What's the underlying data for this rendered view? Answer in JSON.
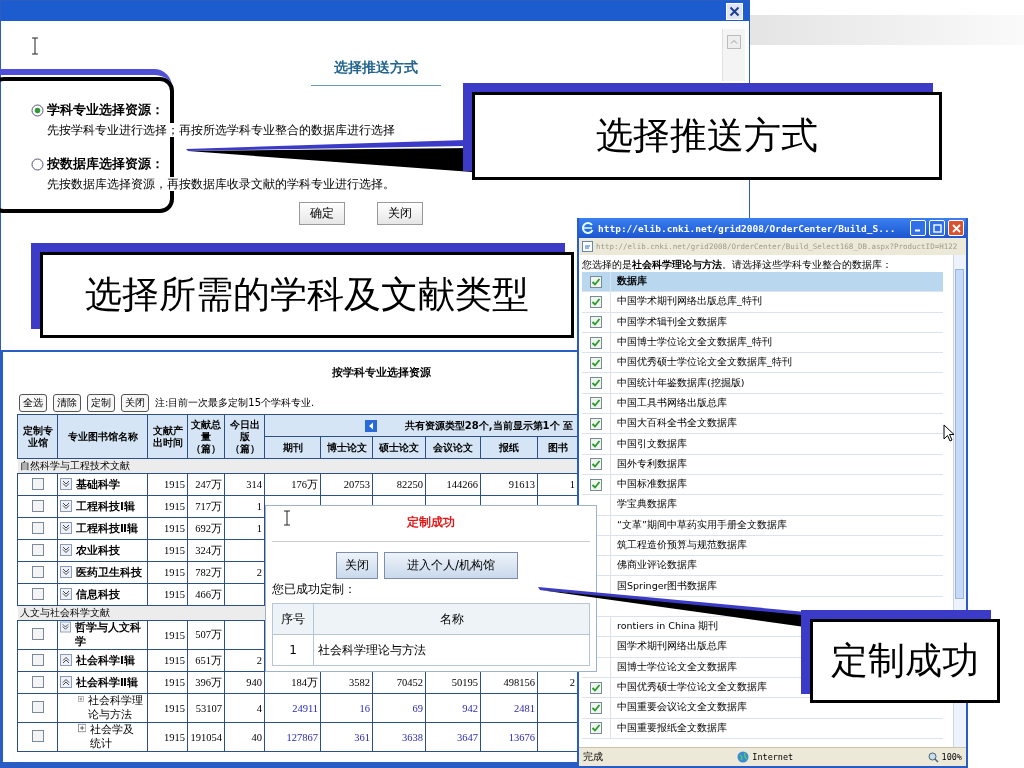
{
  "push_dialog": {
    "heading": "选择推送方式",
    "options": [
      {
        "label": "学科专业选择资源：",
        "description": "先按学科专业进行选择；再按所选学科专业整合的数据库进行选择",
        "selected": true
      },
      {
        "label": "按数据库选择资源：",
        "description": "先按数据库选择资源，再按数据库收录文献的学科专业进行选择。",
        "selected": false
      }
    ],
    "buttons": [
      "确定",
      "关闭"
    ]
  },
  "subject_window": {
    "heading": "按学科专业选择资源",
    "toolbar": [
      "全选",
      "清除",
      "定制",
      "关闭"
    ],
    "note": "注:目前一次最多定制15个学科专业.",
    "columns": [
      "定制专业馆",
      "专业图书馆名称",
      "文献产出时间",
      "文献总量（篇）",
      "今日出版（篇）"
    ],
    "type_summary": "共有资源类型28个,当前显示第1个  至",
    "type_columns": [
      "期刊",
      "博士论文",
      "硕士论文",
      "会议论文",
      "报纸",
      "图书"
    ],
    "rows": [
      {
        "kind": "group",
        "label": "自然科学与工程技术文献"
      },
      {
        "kind": "library",
        "name": "基础科学",
        "checked": false,
        "expanded": false,
        "cells": [
          "1915",
          "247万",
          "314",
          "176万",
          "20753",
          "82250",
          "144266",
          "91613",
          "1"
        ]
      },
      {
        "kind": "library",
        "name": "工程科技Ⅰ辑",
        "checked": false,
        "expanded": false,
        "cells": [
          "1915",
          "717万",
          "1"
        ]
      },
      {
        "kind": "library",
        "name": "工程科技Ⅱ辑",
        "checked": false,
        "expanded": false,
        "cells": [
          "1915",
          "692万",
          "1"
        ]
      },
      {
        "kind": "library",
        "name": "农业科技",
        "checked": false,
        "expanded": false,
        "cells": [
          "1915",
          "324万"
        ]
      },
      {
        "kind": "library",
        "name": "医药卫生科技",
        "checked": false,
        "expanded": false,
        "cells": [
          "1915",
          "782万",
          "2"
        ]
      },
      {
        "kind": "library",
        "name": "信息科技",
        "checked": false,
        "expanded": false,
        "cells": [
          "1915",
          "466万"
        ]
      },
      {
        "kind": "group",
        "label": "人文与社会科学文献"
      },
      {
        "kind": "library",
        "name": "哲学与人文科学",
        "checked": false,
        "expanded": false,
        "cells": [
          "1915",
          "507万"
        ]
      },
      {
        "kind": "library",
        "name": "社会科学Ⅰ辑",
        "checked": false,
        "expanded": true,
        "cells": [
          "1915",
          "651万",
          "2"
        ]
      },
      {
        "kind": "library",
        "name": "社会科学Ⅱ辑",
        "checked": false,
        "expanded": true,
        "cells": [
          "1915",
          "396万",
          "940",
          "184万",
          "3582",
          "70452",
          "50195",
          "498156",
          "2"
        ],
        "children": [
          {
            "kind": "library",
            "name": "社会科学理论与方法",
            "checked": false,
            "expanded": false,
            "cells": [
              "1915",
              "53107",
              "4",
              "24911",
              "16",
              "69",
              "942",
              "2481"
            ]
          },
          {
            "kind": "library",
            "name": "社会学及统计",
            "checked": false,
            "expanded": false,
            "cells": [
              "1915",
              "191054",
              "40",
              "127867",
              "361",
              "3638",
              "3647",
              "13676"
            ]
          }
        ]
      }
    ]
  },
  "database_window": {
    "title": "http://elib.cnki.net/grid2008/OrderCenter/Build_S...",
    "address": "http://elib.cnki.net/grid2008/OrderCenter/Build_Select168_DB.aspx?ProductID=H122",
    "intro": "您选择的是**社会科学理论与方法**。请选择这些学科专业整合的数据库：",
    "header": {
      "label": "数据库",
      "checked": true
    },
    "items": [
      {
        "label": "中国学术期刊网络出版总库_特刊",
        "checked": true
      },
      {
        "label": "中国学术辑刊全文数据库",
        "checked": true
      },
      {
        "label": "中国博士学位论文全文数据库_特刊",
        "checked": true
      },
      {
        "label": "中国优秀硕士学位论文全文数据库_特刊",
        "checked": true
      },
      {
        "label": "中国统计年鉴数据库(挖掘版)",
        "checked": true
      },
      {
        "label": "中国工具书网络出版总库",
        "checked": true
      },
      {
        "label": "中国大百科全书全文数据库",
        "checked": true
      },
      {
        "label": "中国引文数据库",
        "checked": true
      },
      {
        "label": "国外专利数据库",
        "checked": true
      },
      {
        "label": "中国标准数据库",
        "checked": true
      },
      {
        "label": "学宝典数据库"
      },
      {
        "label": "“文革”期间中草药实用手册全文数据库"
      },
      {
        "label": "筑工程造价预算与规范数据库"
      },
      {
        "label": "佛商业评论数据库"
      },
      {
        "label": "国Springer图书数据库"
      },
      {
        "kind": "obscured"
      },
      {
        "label": "rontiers in China 期刊"
      },
      {
        "label": "国学术期刊网络出版总库"
      },
      {
        "label": "国博士学位论文全文数据库"
      },
      {
        "label": "中国优秀硕士学位论文全文数据库",
        "checked": true
      },
      {
        "label": "中国重要会议论文全文数据库",
        "checked": true
      },
      {
        "label": "中国重要报纸全文数据库",
        "checked": true
      }
    ],
    "status": "完成",
    "zone": "Internet",
    "zoom": "100%"
  },
  "success_dialog": {
    "heading": "定制成功",
    "buttons": [
      "关闭",
      "进入个人/机构馆"
    ],
    "summary": "您已成功定制：",
    "columns": [
      "序号",
      "名称"
    ],
    "rows": [
      [
        "1",
        "社会科学理论与方法"
      ]
    ]
  },
  "callouts": [
    {
      "text": "选择推送方式"
    },
    {
      "text": "选择所需的学科及文献类型"
    },
    {
      "text": "定制成功"
    }
  ]
}
